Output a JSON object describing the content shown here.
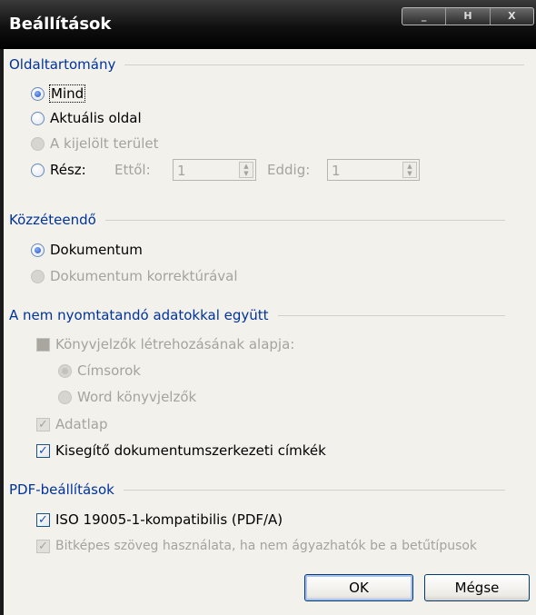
{
  "window": {
    "title": "Beállítások",
    "caption_buttons": [
      "_",
      "H",
      "X"
    ]
  },
  "page_range": {
    "header": "Oldaltartomány",
    "all": {
      "label": "Mind",
      "selected": true,
      "enabled": true
    },
    "current": {
      "label": "Aktuális oldal",
      "selected": false,
      "enabled": true
    },
    "selection": {
      "label": "A kijelölt terület",
      "selected": false,
      "enabled": false
    },
    "pages": {
      "label": "Rész:",
      "from_label": "Ettől:",
      "from_value": "1",
      "to_label": "Eddig:",
      "to_value": "1",
      "selected": false,
      "enabled": true
    }
  },
  "publish": {
    "header": "Közzéteendő",
    "document": {
      "label": "Dokumentum",
      "selected": true,
      "enabled": true
    },
    "document_markup": {
      "label": "Dokumentum korrektúrával",
      "selected": false,
      "enabled": false
    }
  },
  "non_printing": {
    "header": "A nem nyomtatandó adatokkal együtt",
    "create_bookmarks": {
      "label": "Könyvjelzők létrehozásának alapja:",
      "checked": false,
      "enabled": false
    },
    "headings": {
      "label": "Címsorok",
      "selected": true,
      "enabled": false
    },
    "word_bookmarks": {
      "label": "Word könyvjelzők",
      "selected": false,
      "enabled": false
    },
    "doc_properties": {
      "label": "Adatlap",
      "checked": true,
      "enabled": false
    },
    "structure_tags": {
      "label": "Kisegítő dokumentumszerkezeti címkék",
      "checked": true,
      "enabled": true
    }
  },
  "pdf_options": {
    "header": "PDF-beállítások",
    "iso": {
      "label": "ISO 19005-1-kompatibilis (PDF/A)",
      "checked": true,
      "enabled": true
    },
    "bitmap_text": {
      "label": "Bitképes szöveg használata, ha nem ágyazhatók be a betűtípusok",
      "checked": true,
      "enabled": false
    }
  },
  "buttons": {
    "ok": "OK",
    "cancel": "Mégse"
  }
}
